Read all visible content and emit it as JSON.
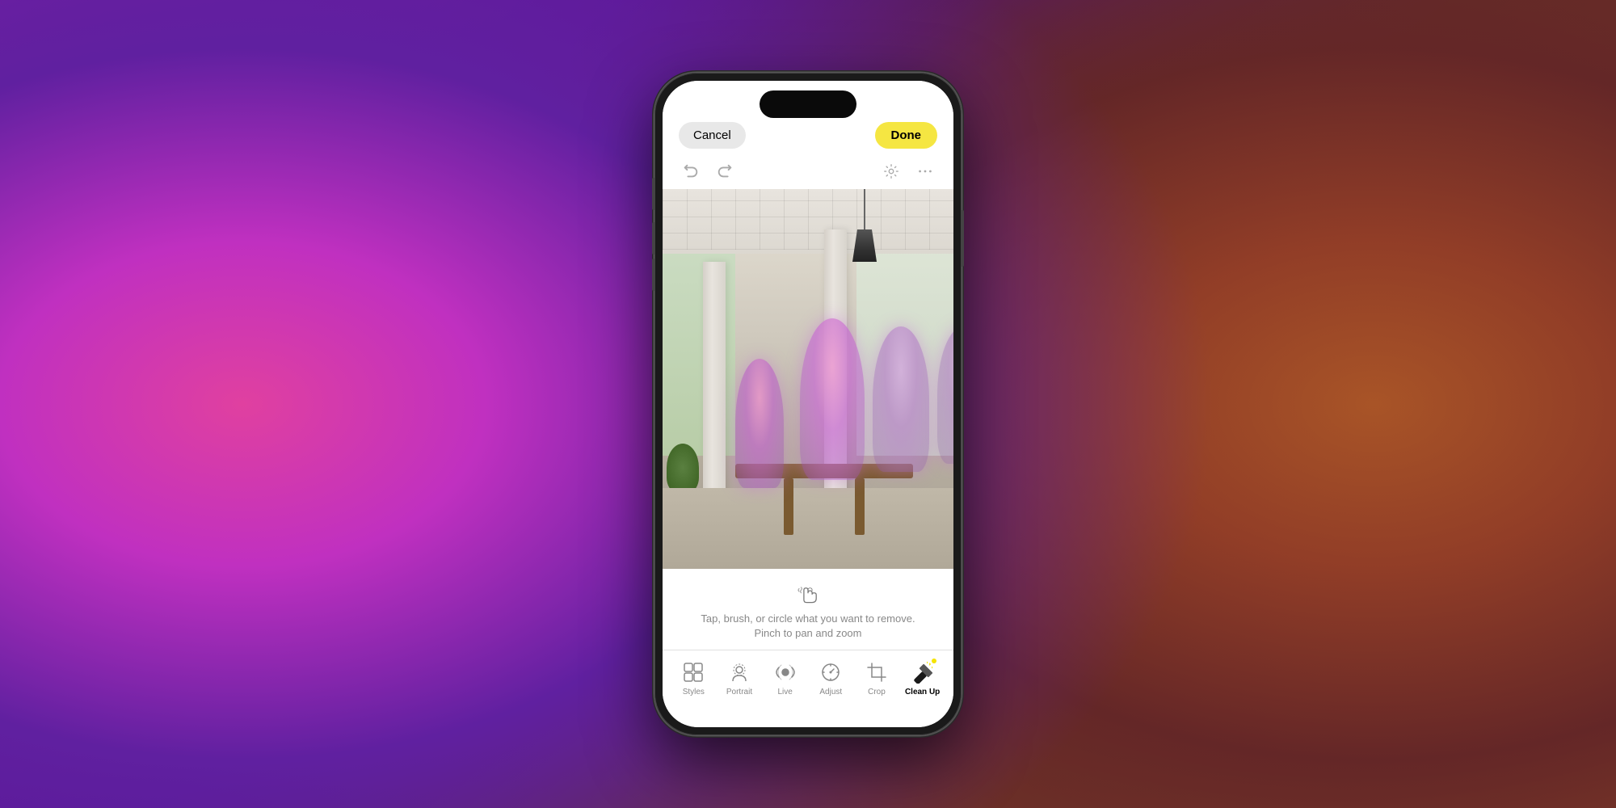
{
  "background": {
    "gradient_desc": "pink-purple to orange gradient"
  },
  "phone": {
    "top_bar": {
      "cancel_label": "Cancel",
      "done_label": "Done"
    },
    "toolbar": {
      "undo_icon": "undo-icon",
      "redo_icon": "redo-icon",
      "auto_icon": "auto-enhance-icon",
      "more_icon": "more-icon"
    },
    "instruction": {
      "icon": "brush-hand-icon",
      "line1": "Tap, brush, or circle what you want to remove.",
      "line2": "Pinch to pan and zoom"
    },
    "bottom_tools": [
      {
        "id": "styles",
        "label": "Styles",
        "icon": "grid-icon",
        "active": false
      },
      {
        "id": "portrait",
        "label": "Portrait",
        "icon": "f-icon",
        "active": false
      },
      {
        "id": "live",
        "label": "Live",
        "icon": "live-icon",
        "active": false
      },
      {
        "id": "adjust",
        "label": "Adjust",
        "icon": "adjust-icon",
        "active": false
      },
      {
        "id": "crop",
        "label": "Crop",
        "icon": "crop-icon",
        "active": false
      },
      {
        "id": "cleanup",
        "label": "Clean Up",
        "icon": "magic-wand-icon",
        "active": true
      }
    ]
  }
}
